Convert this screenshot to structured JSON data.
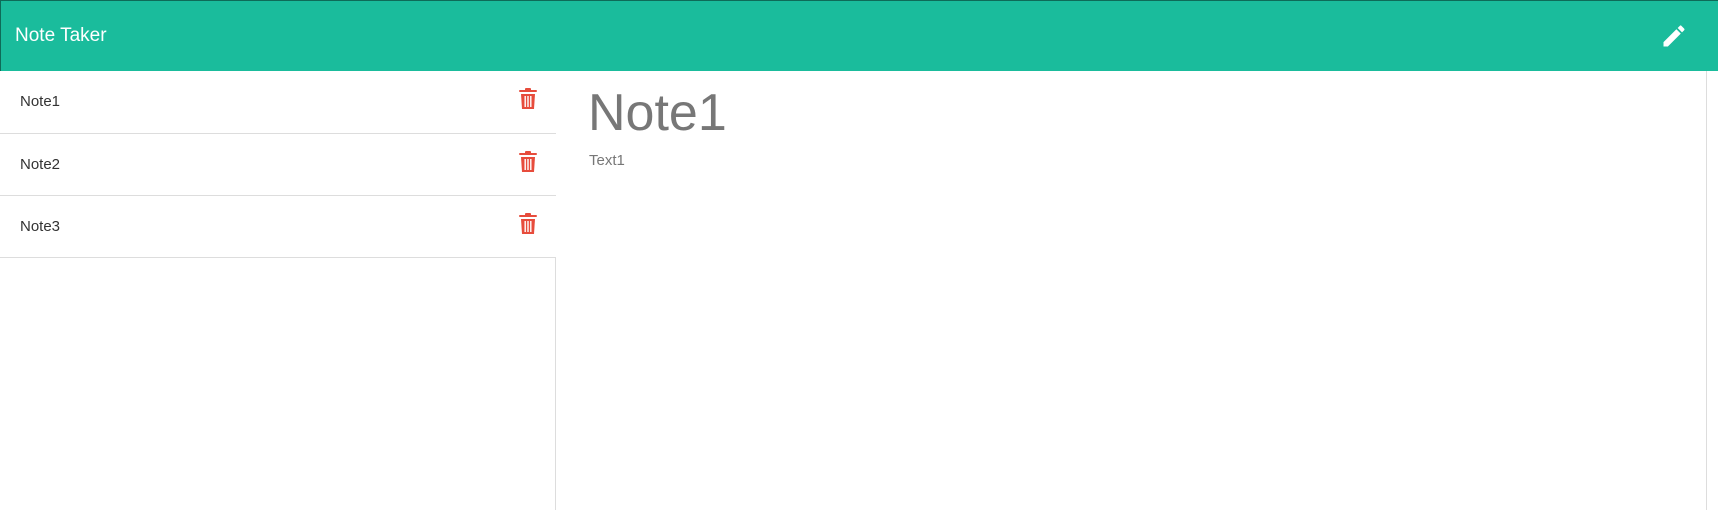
{
  "header": {
    "title": "Note Taker",
    "new_note_icon": "pencil-icon"
  },
  "sidebar": {
    "notes": [
      {
        "title": "Note1",
        "delete_icon": "trash-icon"
      },
      {
        "title": "Note2",
        "delete_icon": "trash-icon"
      },
      {
        "title": "Note3",
        "delete_icon": "trash-icon"
      }
    ]
  },
  "main": {
    "note_title": "Note1",
    "note_text": "Text1"
  },
  "colors": {
    "navbar": "#1abc9c",
    "delete": "#e74c3c",
    "note_text": "#777777"
  }
}
